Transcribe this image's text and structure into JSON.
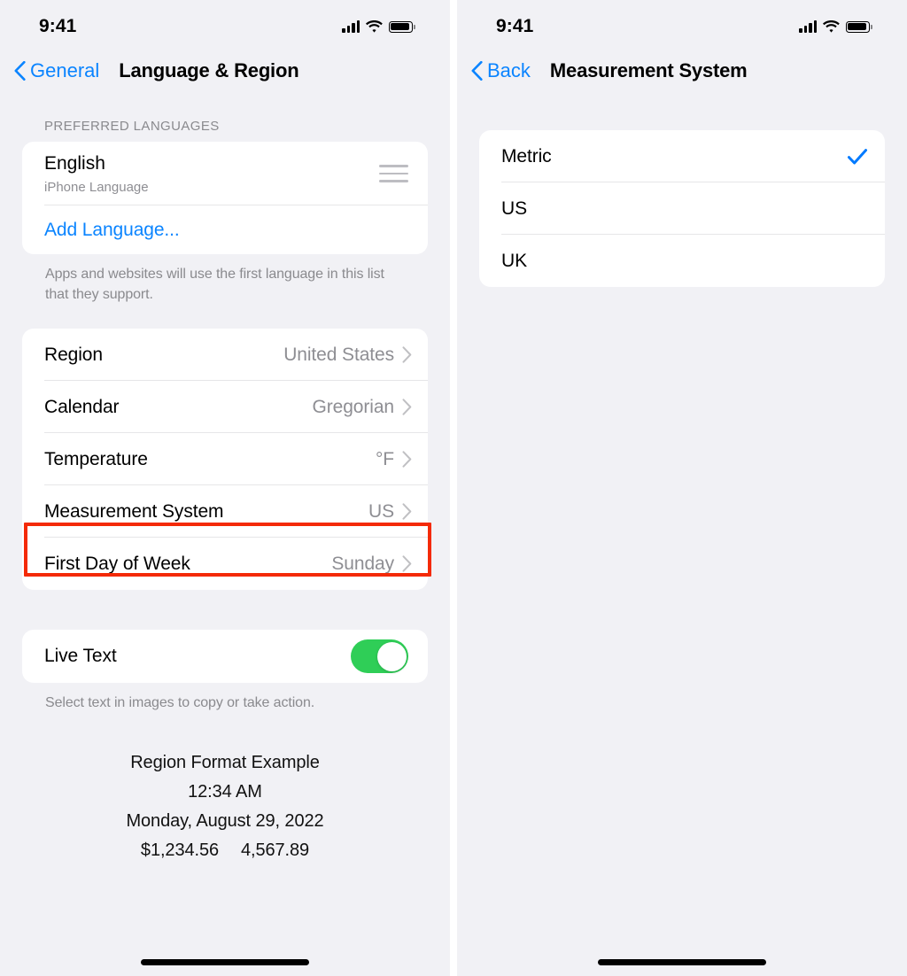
{
  "left_screen": {
    "status_bar": {
      "time": "9:41",
      "cellular": "cellular-bars-icon",
      "wifi": "wifi-icon",
      "battery": "battery-full-icon"
    },
    "nav": {
      "back_label": "General",
      "title": "Language & Region"
    },
    "languages_section": {
      "header": "PREFERRED LANGUAGES",
      "language_title": "English",
      "language_subtitle": "iPhone Language",
      "reorder_icon": "reorder-handle-icon",
      "add_language_label": "Add Language...",
      "footnote": "Apps and websites will use the first language in this list that they support."
    },
    "settings_rows": [
      {
        "label": "Region",
        "value": "United States",
        "highlighted": false
      },
      {
        "label": "Calendar",
        "value": "Gregorian",
        "highlighted": false
      },
      {
        "label": "Temperature",
        "value": "°F",
        "highlighted": false
      },
      {
        "label": "Measurement System",
        "value": "US",
        "highlighted": true
      },
      {
        "label": "First Day of Week",
        "value": "Sunday",
        "highlighted": false
      }
    ],
    "live_text": {
      "label": "Live Text",
      "toggle_state": "on",
      "footnote": "Select text in images to copy or take action."
    },
    "region_example": {
      "title": "Region Format Example",
      "time": "12:34 AM",
      "date": "Monday, August 29, 2022",
      "currency": "$1,234.56",
      "number": "4,567.89"
    }
  },
  "right_screen": {
    "status_bar": {
      "time": "9:41",
      "cellular": "cellular-bars-icon",
      "wifi": "wifi-icon",
      "battery": "battery-full-icon"
    },
    "nav": {
      "back_label": "Back",
      "title": "Measurement System"
    },
    "options": [
      {
        "label": "Metric",
        "selected": true
      },
      {
        "label": "US",
        "selected": false
      },
      {
        "label": "UK",
        "selected": false
      }
    ]
  },
  "colors": {
    "accent_blue": "#0a84ff",
    "toggle_green": "#2fce57",
    "annotation_red": "#f42a07",
    "screen_background": "#f1f1f5",
    "card_background": "#ffffff",
    "secondary_text": "#8e8e93"
  }
}
